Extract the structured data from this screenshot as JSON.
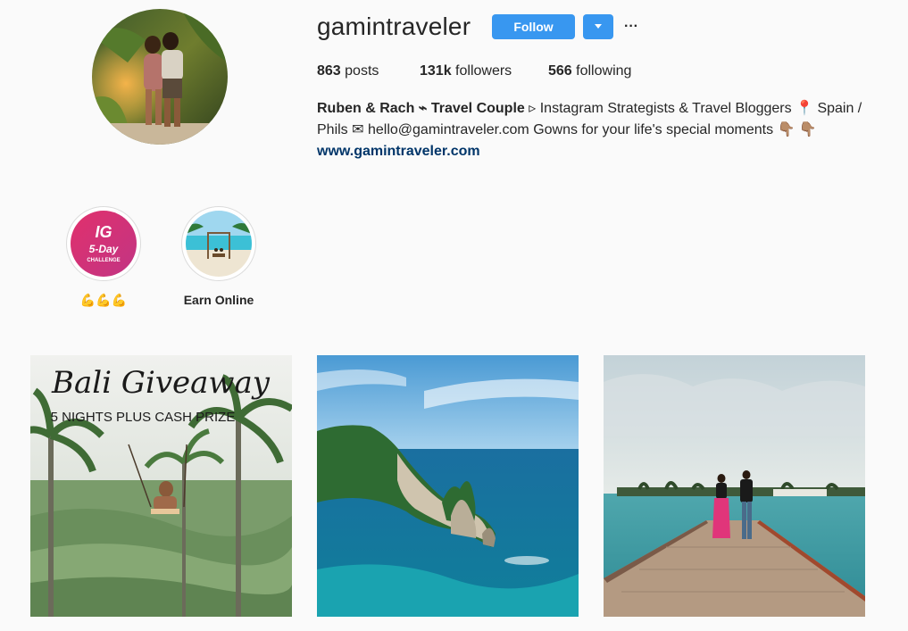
{
  "profile": {
    "username": "gamintraveler",
    "follow_label": "Follow",
    "more_label": "···",
    "stats": {
      "posts_count": "863",
      "posts_label": "posts",
      "followers_count": "131k",
      "followers_label": "followers",
      "following_count": "566",
      "following_label": "following"
    },
    "bio": {
      "name": "Ruben & Rach ⌁ Travel Couple",
      "text": "▹ Instagram Strategists & Travel Bloggers 📍 Spain / Phils ✉ hello@gamintraveler.com Gowns for your life's special moments 👇🏽 👇🏽",
      "link": "www.gamintraveler.com"
    }
  },
  "highlights": [
    {
      "label": "💪💪💪",
      "cover_title": "IG",
      "cover_subtitle": "5-Day",
      "cover_tag": "CHALLENGE"
    },
    {
      "label": "Earn Online"
    }
  ],
  "posts": [
    {
      "overlay_title": "Bali Giveaway",
      "overlay_subtitle": "5 NIGHTS PLUS CASH PRIZE"
    },
    {},
    {}
  ],
  "colors": {
    "accent": "#3897f0",
    "link": "#003569",
    "highlight_gradient_start": "#e1306c",
    "highlight_gradient_end": "#c13584"
  }
}
